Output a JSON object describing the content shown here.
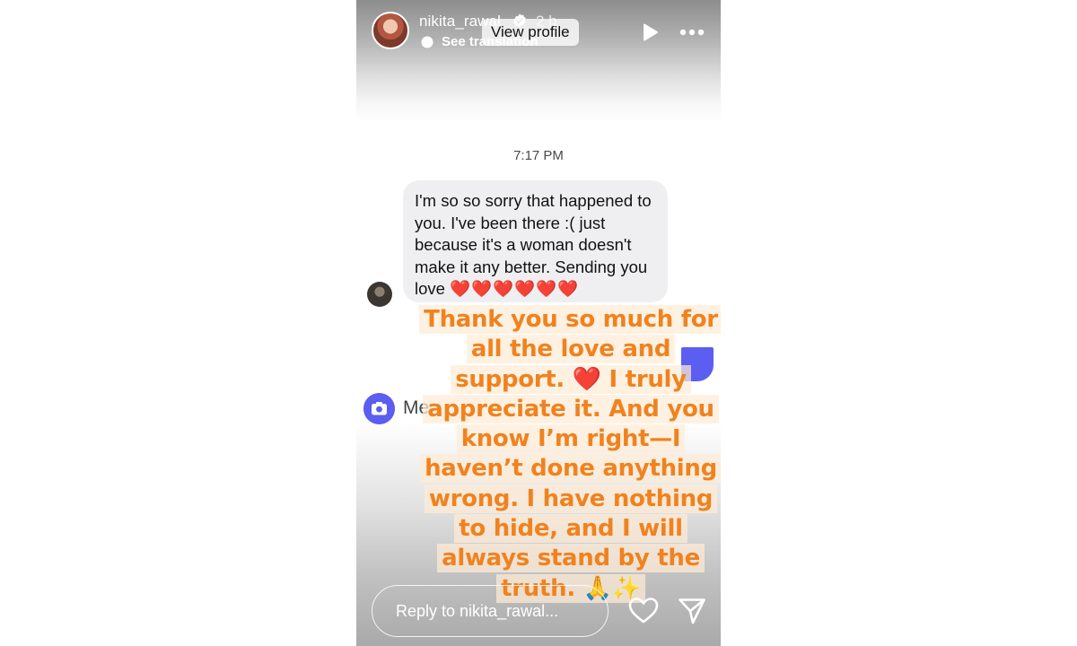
{
  "header": {
    "username": "nikita_rawal",
    "time_ago": "2 h",
    "view_profile": "View profile",
    "see_translation": "See translation"
  },
  "chat": {
    "time": "7:17 PM",
    "message": "I'm so so sorry that happened to you. I've been there :( just because it's a woman doesn't make it any better. Sending you love",
    "message_hearts": "❤️❤️❤️❤️❤️❤️",
    "input_placeholder_peek": "Me"
  },
  "caption": {
    "lines": [
      "Thank you so much for",
      "all the love and",
      "support. ❤️ I truly",
      "appreciate it. And you",
      "know I’m right—I",
      "haven’t done anything",
      "wrong. I have nothing",
      "to hide, and I will",
      "always stand by the",
      "truth. 🙏✨"
    ]
  },
  "reply": {
    "placeholder": "Reply to nikita_rawal..."
  },
  "colors": {
    "caption_text": "#f0821f",
    "caption_highlight": "#ffecd6",
    "accent": "#5b5ef0",
    "heart": "#e4213b"
  },
  "icons": [
    "verified-badge-icon",
    "translate-icon",
    "play-icon",
    "more-options-icon",
    "camera-icon",
    "heart-icon",
    "send-icon"
  ]
}
